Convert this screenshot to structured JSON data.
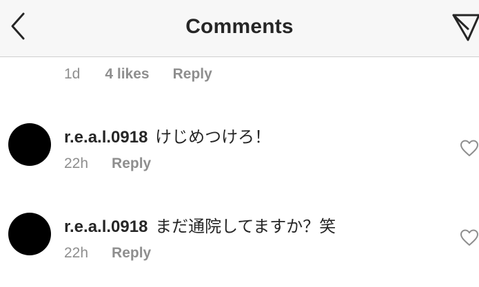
{
  "header": {
    "title": "Comments",
    "back_icon": "chevron-left-icon",
    "share_icon": "paper-plane-icon"
  },
  "top_comment_meta": {
    "time": "1d",
    "likes": "4 likes",
    "reply": "Reply"
  },
  "comments": [
    {
      "username": "r.e.a.l.0918",
      "text": "けじめつけろ！",
      "time": "22h",
      "reply": "Reply",
      "like_icon": "heart-outline-icon"
    },
    {
      "username": "r.e.a.l.0918",
      "text": "まだ通院してますか？笑",
      "time": "22h",
      "reply": "Reply",
      "like_icon": "heart-outline-icon"
    }
  ],
  "colors": {
    "header_bg": "#f7f7f7",
    "text_primary": "#262626",
    "text_secondary": "#8e8e8e",
    "divider": "#cfcfcf"
  }
}
